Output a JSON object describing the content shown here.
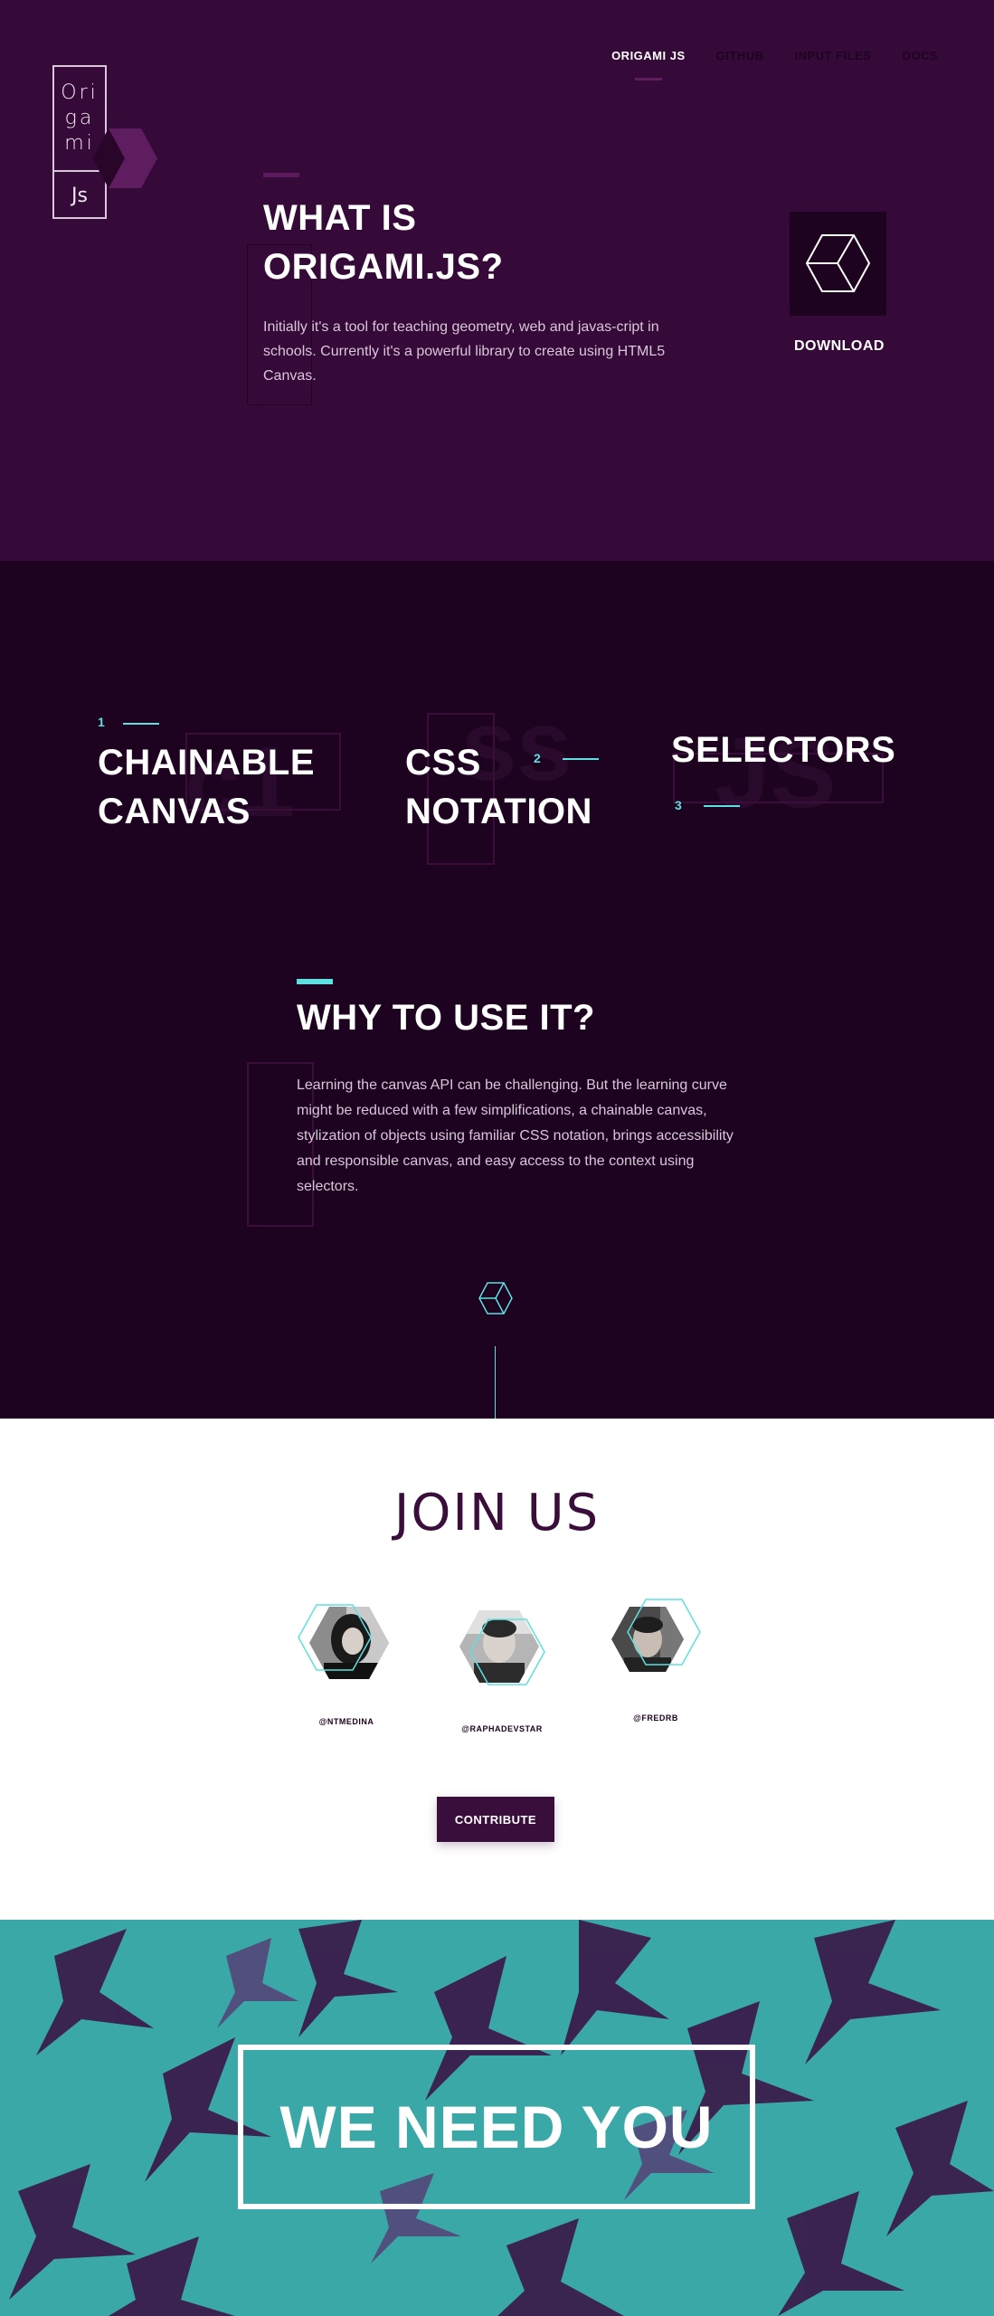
{
  "logo": {
    "lines": [
      "Ori",
      "ga",
      "mi"
    ],
    "suffix": "Js"
  },
  "nav": {
    "items": [
      {
        "label": "ORIGAMI JS",
        "active": true
      },
      {
        "label": "GITHUB",
        "active": false
      },
      {
        "label": "INPUT FILES",
        "active": false
      },
      {
        "label": "DOCS",
        "active": false
      }
    ]
  },
  "hero": {
    "title": "WHAT IS ORIGAMI.JS?",
    "description": "Initially it's a tool for teaching geometry, web and javas-cript in schools. Currently it's a powerful library to create using HTML5 Canvas.",
    "download_label": "DOWNLOAD",
    "download_icon": "cube-icon"
  },
  "features": {
    "items": [
      {
        "number": "1",
        "title": "CHAINABLE CANVAS"
      },
      {
        "number": "2",
        "title": "CSS NOTATION"
      },
      {
        "number": "3",
        "title": "SELECTORS"
      }
    ],
    "watermarks": [
      "c1",
      "ss",
      "JS"
    ]
  },
  "why": {
    "title": "WHY TO USE IT?",
    "description": "Learning the canvas API can be challenging. But the learning curve might be reduced with a few simplifications, a chainable canvas, stylization of objects using familiar CSS notation, brings accessibility and responsible canvas, and easy access to the context using selectors."
  },
  "join": {
    "title": "JOIN US",
    "members": [
      {
        "handle": "@NTMEDINA"
      },
      {
        "handle": "@RAPHADEVSTAR"
      },
      {
        "handle": "@FREDRB"
      }
    ],
    "contribute_label": "CONTRIBUTE"
  },
  "cta": {
    "title": "WE NEED YOU"
  },
  "colors": {
    "hero_bg": "#360a38",
    "features_bg": "#1e0320",
    "accent": "#5fe0e0",
    "brand": "#3a0e3b",
    "cta_bg": "#3aa8a6"
  }
}
